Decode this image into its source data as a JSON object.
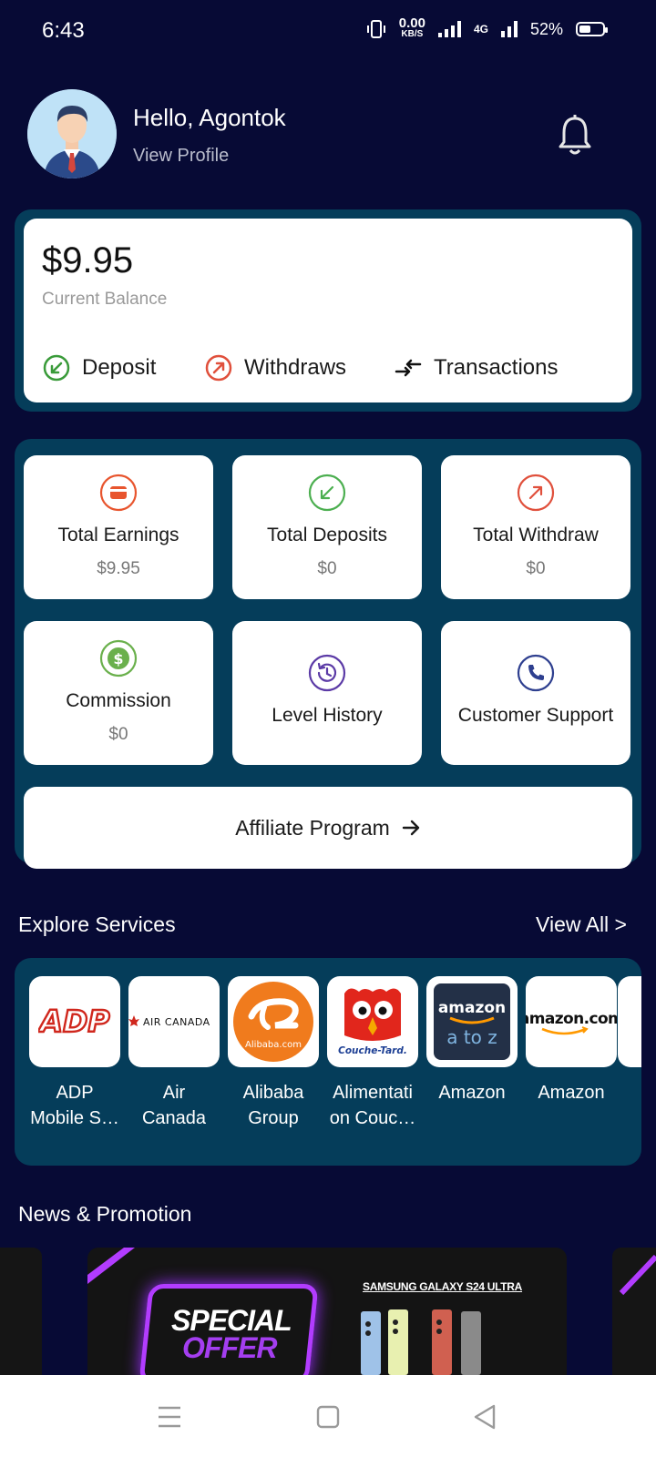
{
  "status_bar": {
    "time": "6:43",
    "net_speed_value": "0.00",
    "net_speed_unit": "KB/S",
    "network": "4G",
    "battery_percent": "52%"
  },
  "header": {
    "greeting": "Hello, Agontok",
    "view_profile": "View Profile"
  },
  "balance": {
    "amount": "$9.95",
    "label": "Current Balance",
    "actions": [
      {
        "label": "Deposit",
        "icon": "arrow-down-left-circle-icon",
        "color": "#3a9b3a"
      },
      {
        "label": "Withdraws",
        "icon": "arrow-up-right-circle-icon",
        "color": "#e0503c"
      },
      {
        "label": "Transactions",
        "icon": "swap-arrows-icon",
        "color": "#111111"
      }
    ]
  },
  "stats": {
    "tiles": [
      {
        "title": "Total Earnings",
        "value": "$9.95",
        "icon": "wallet-icon",
        "color": "#e8552e"
      },
      {
        "title": "Total Deposits",
        "value": "$0",
        "icon": "arrow-down-left-circle-icon",
        "color": "#4caf50"
      },
      {
        "title": "Total Withdraw",
        "value": "$0",
        "icon": "arrow-up-right-circle-icon",
        "color": "#e0503c"
      },
      {
        "title": "Commission",
        "value": "$0",
        "icon": "dollar-coin-icon",
        "color": "#6ab04c"
      },
      {
        "title": "Level History",
        "value": "",
        "icon": "history-icon",
        "color": "#5b3aa6"
      },
      {
        "title": "Customer Support",
        "value": "",
        "icon": "phone-icon",
        "color": "#2e3f8f"
      }
    ],
    "affiliate_label": "Affiliate Program"
  },
  "explore": {
    "title": "Explore Services",
    "view_all": "View All >",
    "services": [
      {
        "name_line1": "ADP",
        "name_line2": "Mobile S…",
        "logo_text": "ADP"
      },
      {
        "name_line1": "Air",
        "name_line2": "Canada",
        "logo_text": "AIR CANADA"
      },
      {
        "name_line1": "Alibaba",
        "name_line2": "Group",
        "logo_text": "Alibaba.com"
      },
      {
        "name_line1": "Alimentati",
        "name_line2": "on Couc…",
        "logo_text": "Couche-Tard."
      },
      {
        "name_line1": "Amazon",
        "name_line2": "",
        "logo_text_1": "amazon",
        "logo_text_2": "a to z"
      },
      {
        "name_line1": "Amazon",
        "name_line2": "",
        "logo_text": "amazon.com"
      }
    ]
  },
  "news": {
    "title": "News & Promotion",
    "banner_headline": "SAMSUNG GALAXY S24 ULTRA",
    "banner_line1": "SPECIAL",
    "banner_line2": "OFFER"
  },
  "colors": {
    "background": "#070a35",
    "panel": "#053d5a",
    "card": "#ffffff"
  }
}
